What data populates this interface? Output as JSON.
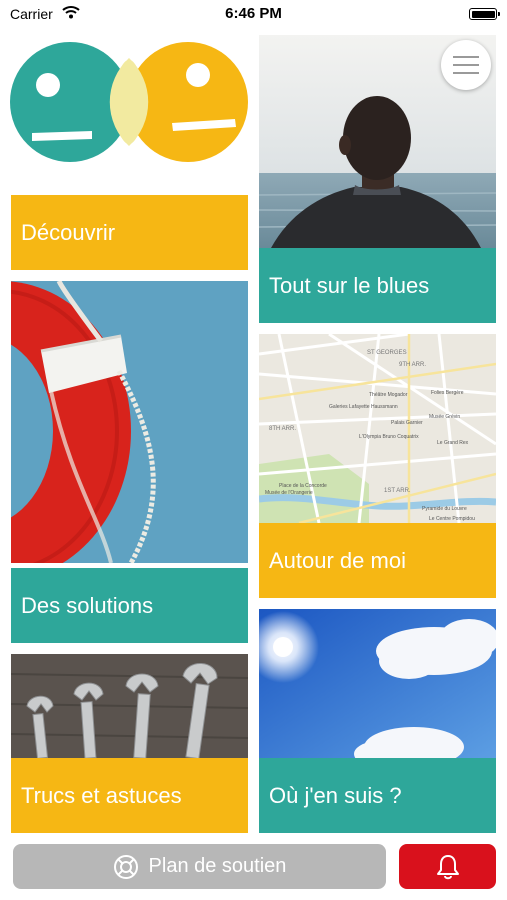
{
  "status_bar": {
    "carrier": "Carrier",
    "time": "6:46 PM"
  },
  "logo": {
    "name": "ge-logo",
    "colors": {
      "teal": "#2ea79a",
      "orange": "#f6b714",
      "overlap": "#f2eaa0"
    }
  },
  "menu": {
    "icon": "hamburger-icon"
  },
  "tiles": {
    "decouvrir": {
      "label": "Découvrir",
      "color": "#f6b714"
    },
    "blues": {
      "label": "Tout sur le blues",
      "color": "#2ea79a"
    },
    "solutions": {
      "label": "Des solutions",
      "color": "#2ea79a"
    },
    "autour": {
      "label": "Autour de moi",
      "color": "#f6b714"
    },
    "trucs": {
      "label": "Trucs et astuces",
      "color": "#f6b714"
    },
    "ou": {
      "label": "Où j'en suis ?",
      "color": "#2ea79a"
    }
  },
  "map": {
    "labels": [
      "ST GEORGES",
      "9TH ARR.",
      "Théâtre Mogador",
      "Galeries Lafayette Haussmann",
      "Musée Grévin",
      "Palais Garnier",
      "Folies Bergère",
      "L'Olympia Bruno Coquatrix",
      "Le Grand Rex",
      "8TH ARR.",
      "Place de la Concorde",
      "Musée de l'Orangerie",
      "1ST ARR.",
      "Pyramide du Louvre",
      "Le Centre Pompidou"
    ]
  },
  "bottom_bar": {
    "support_label": "Plan de soutien",
    "support_icon": "lifebuoy-icon",
    "alert_icon": "bell-icon",
    "support_color": "#b7b7b7",
    "alert_color": "#d9111c"
  }
}
